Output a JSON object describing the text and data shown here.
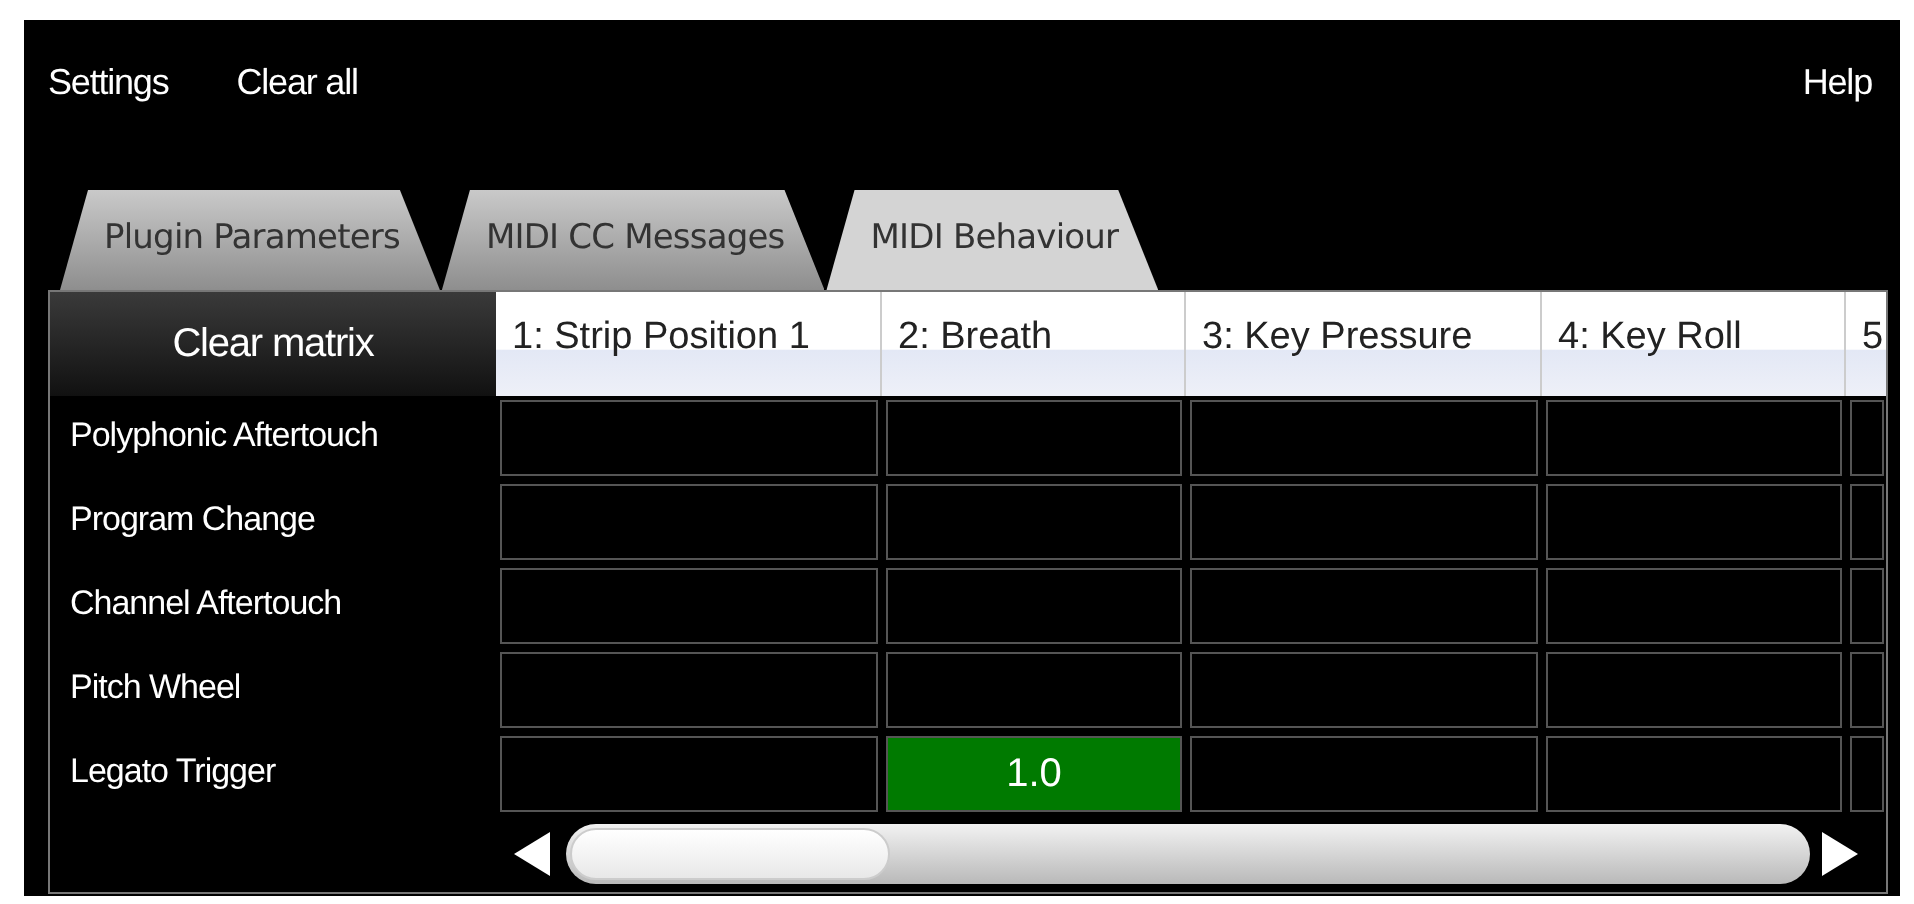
{
  "menu": {
    "left": [
      "Settings",
      "Clear all"
    ],
    "right": [
      "Help"
    ]
  },
  "tabs": [
    {
      "label": "Plugin Parameters",
      "selected": false
    },
    {
      "label": "MIDI CC Messages",
      "selected": false
    },
    {
      "label": "MIDI Behaviour",
      "selected": true
    }
  ],
  "matrix": {
    "corner_button": "Clear matrix",
    "columns": [
      "1: Strip Position 1",
      "2: Breath",
      "3: Key Pressure",
      "4: Key Roll",
      "5"
    ],
    "rows": [
      {
        "label": "Polyphonic Aftertouch",
        "cells": [
          {
            "active": false
          },
          {
            "active": false
          },
          {
            "active": false
          },
          {
            "active": false
          },
          {
            "active": false
          }
        ]
      },
      {
        "label": "Program Change",
        "cells": [
          {
            "active": false
          },
          {
            "active": false
          },
          {
            "active": false
          },
          {
            "active": false
          },
          {
            "active": false
          }
        ]
      },
      {
        "label": "Channel Aftertouch",
        "cells": [
          {
            "active": false
          },
          {
            "active": false
          },
          {
            "active": false
          },
          {
            "active": false
          },
          {
            "active": false
          }
        ]
      },
      {
        "label": "Pitch Wheel",
        "cells": [
          {
            "active": false
          },
          {
            "active": false
          },
          {
            "active": false
          },
          {
            "active": false
          },
          {
            "active": false
          }
        ]
      },
      {
        "label": "Legato Trigger",
        "cells": [
          {
            "active": false
          },
          {
            "active": true,
            "value": "1.0"
          },
          {
            "active": false
          },
          {
            "active": false
          },
          {
            "active": false
          }
        ]
      }
    ]
  }
}
